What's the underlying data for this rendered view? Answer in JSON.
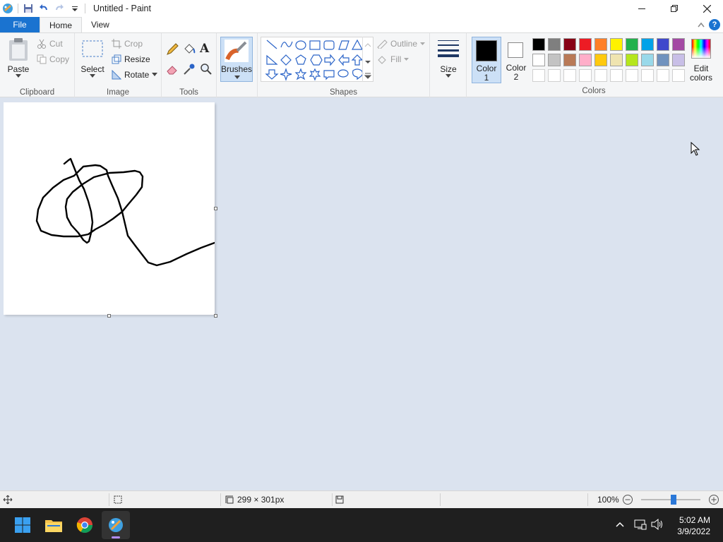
{
  "window": {
    "title": "Untitled - Paint"
  },
  "tabs": {
    "file": "File",
    "home": "Home",
    "view": "View"
  },
  "ribbon": {
    "clipboard": {
      "label": "Clipboard",
      "paste": "Paste",
      "cut": "Cut",
      "copy": "Copy"
    },
    "image": {
      "label": "Image",
      "select": "Select",
      "crop": "Crop",
      "resize": "Resize",
      "rotate": "Rotate"
    },
    "tools": {
      "label": "Tools",
      "text_tool": "A"
    },
    "brushes": {
      "label": "Brushes"
    },
    "shapes": {
      "label": "Shapes",
      "outline": "Outline",
      "fill": "Fill"
    },
    "size": {
      "label": "Size"
    },
    "color1": {
      "line1": "Color",
      "line2": "1"
    },
    "color2": {
      "line1": "Color",
      "line2": "2"
    },
    "colors": {
      "label": "Colors",
      "edit_line1": "Edit",
      "edit_line2": "colors",
      "row1": [
        "#000000",
        "#7f7f7f",
        "#880015",
        "#ed1c24",
        "#ff7f27",
        "#fff200",
        "#22b14c",
        "#00a2e8",
        "#3f48cc",
        "#a349a4"
      ],
      "row2": [
        "#ffffff",
        "#c3c3c3",
        "#b97a57",
        "#ffaec9",
        "#ffc90e",
        "#efe4b0",
        "#b5e61d",
        "#99d9ea",
        "#7092be",
        "#c8bfe7"
      ],
      "row3": [
        "#ffffff",
        "#ffffff",
        "#ffffff",
        "#ffffff",
        "#ffffff",
        "#ffffff",
        "#ffffff",
        "#ffffff",
        "#ffffff",
        "#ffffff"
      ]
    }
  },
  "status": {
    "canvas_size": "299 × 301px",
    "zoom": "100%",
    "zoom_level": 0.55
  },
  "taskbar": {
    "time": "5:02 AM",
    "date": "3/9/2022"
  },
  "colors": {
    "accent": "#1a73d0",
    "canvas_bg": "#dbe3ef",
    "taskbar": "#1f1f1f"
  }
}
